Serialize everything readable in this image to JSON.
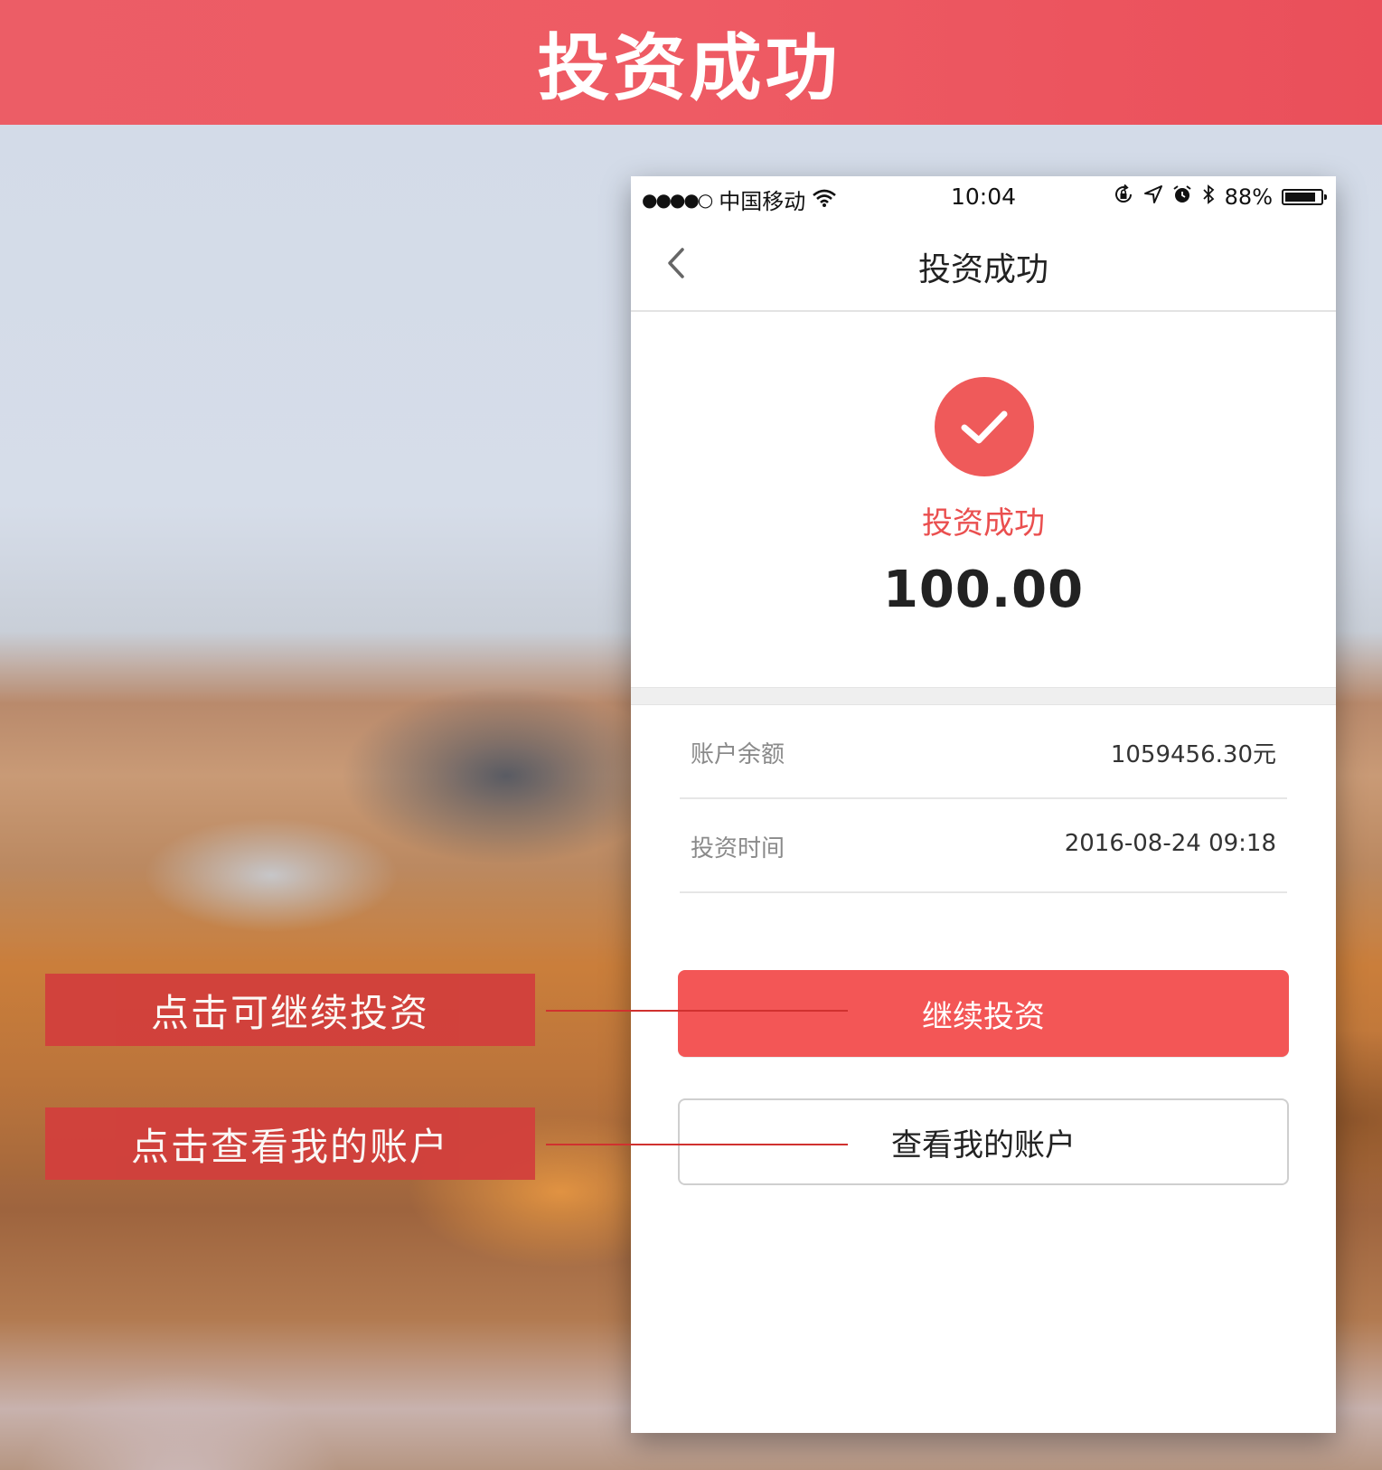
{
  "banner": {
    "title": "投资成功"
  },
  "status_bar": {
    "signal": "●●●●○",
    "carrier": "中国移动",
    "time": "10:04",
    "battery_percent": "88%",
    "battery_level": 0.88,
    "icons": [
      "wifi-icon",
      "rotation-lock-icon",
      "location-icon",
      "alarm-icon",
      "bluetooth-icon",
      "battery-icon"
    ]
  },
  "nav": {
    "title": "投资成功",
    "back_icon": "chevron-left-icon"
  },
  "result": {
    "icon": "checkmark-icon",
    "status_text": "投资成功",
    "amount": "100.00"
  },
  "details": [
    {
      "label": "账户余额",
      "value": "1059456.30元"
    },
    {
      "label": "投资时间",
      "value": "2016-08-24 09:18"
    }
  ],
  "buttons": {
    "continue_label": "继续投资",
    "account_label": "查看我的账户"
  },
  "callouts": {
    "continue": "点击可继续投资",
    "account": "点击查看我的账户"
  },
  "colors": {
    "banner": "#ee5b64",
    "accent": "#f35656",
    "callout": "#d23f3c"
  }
}
